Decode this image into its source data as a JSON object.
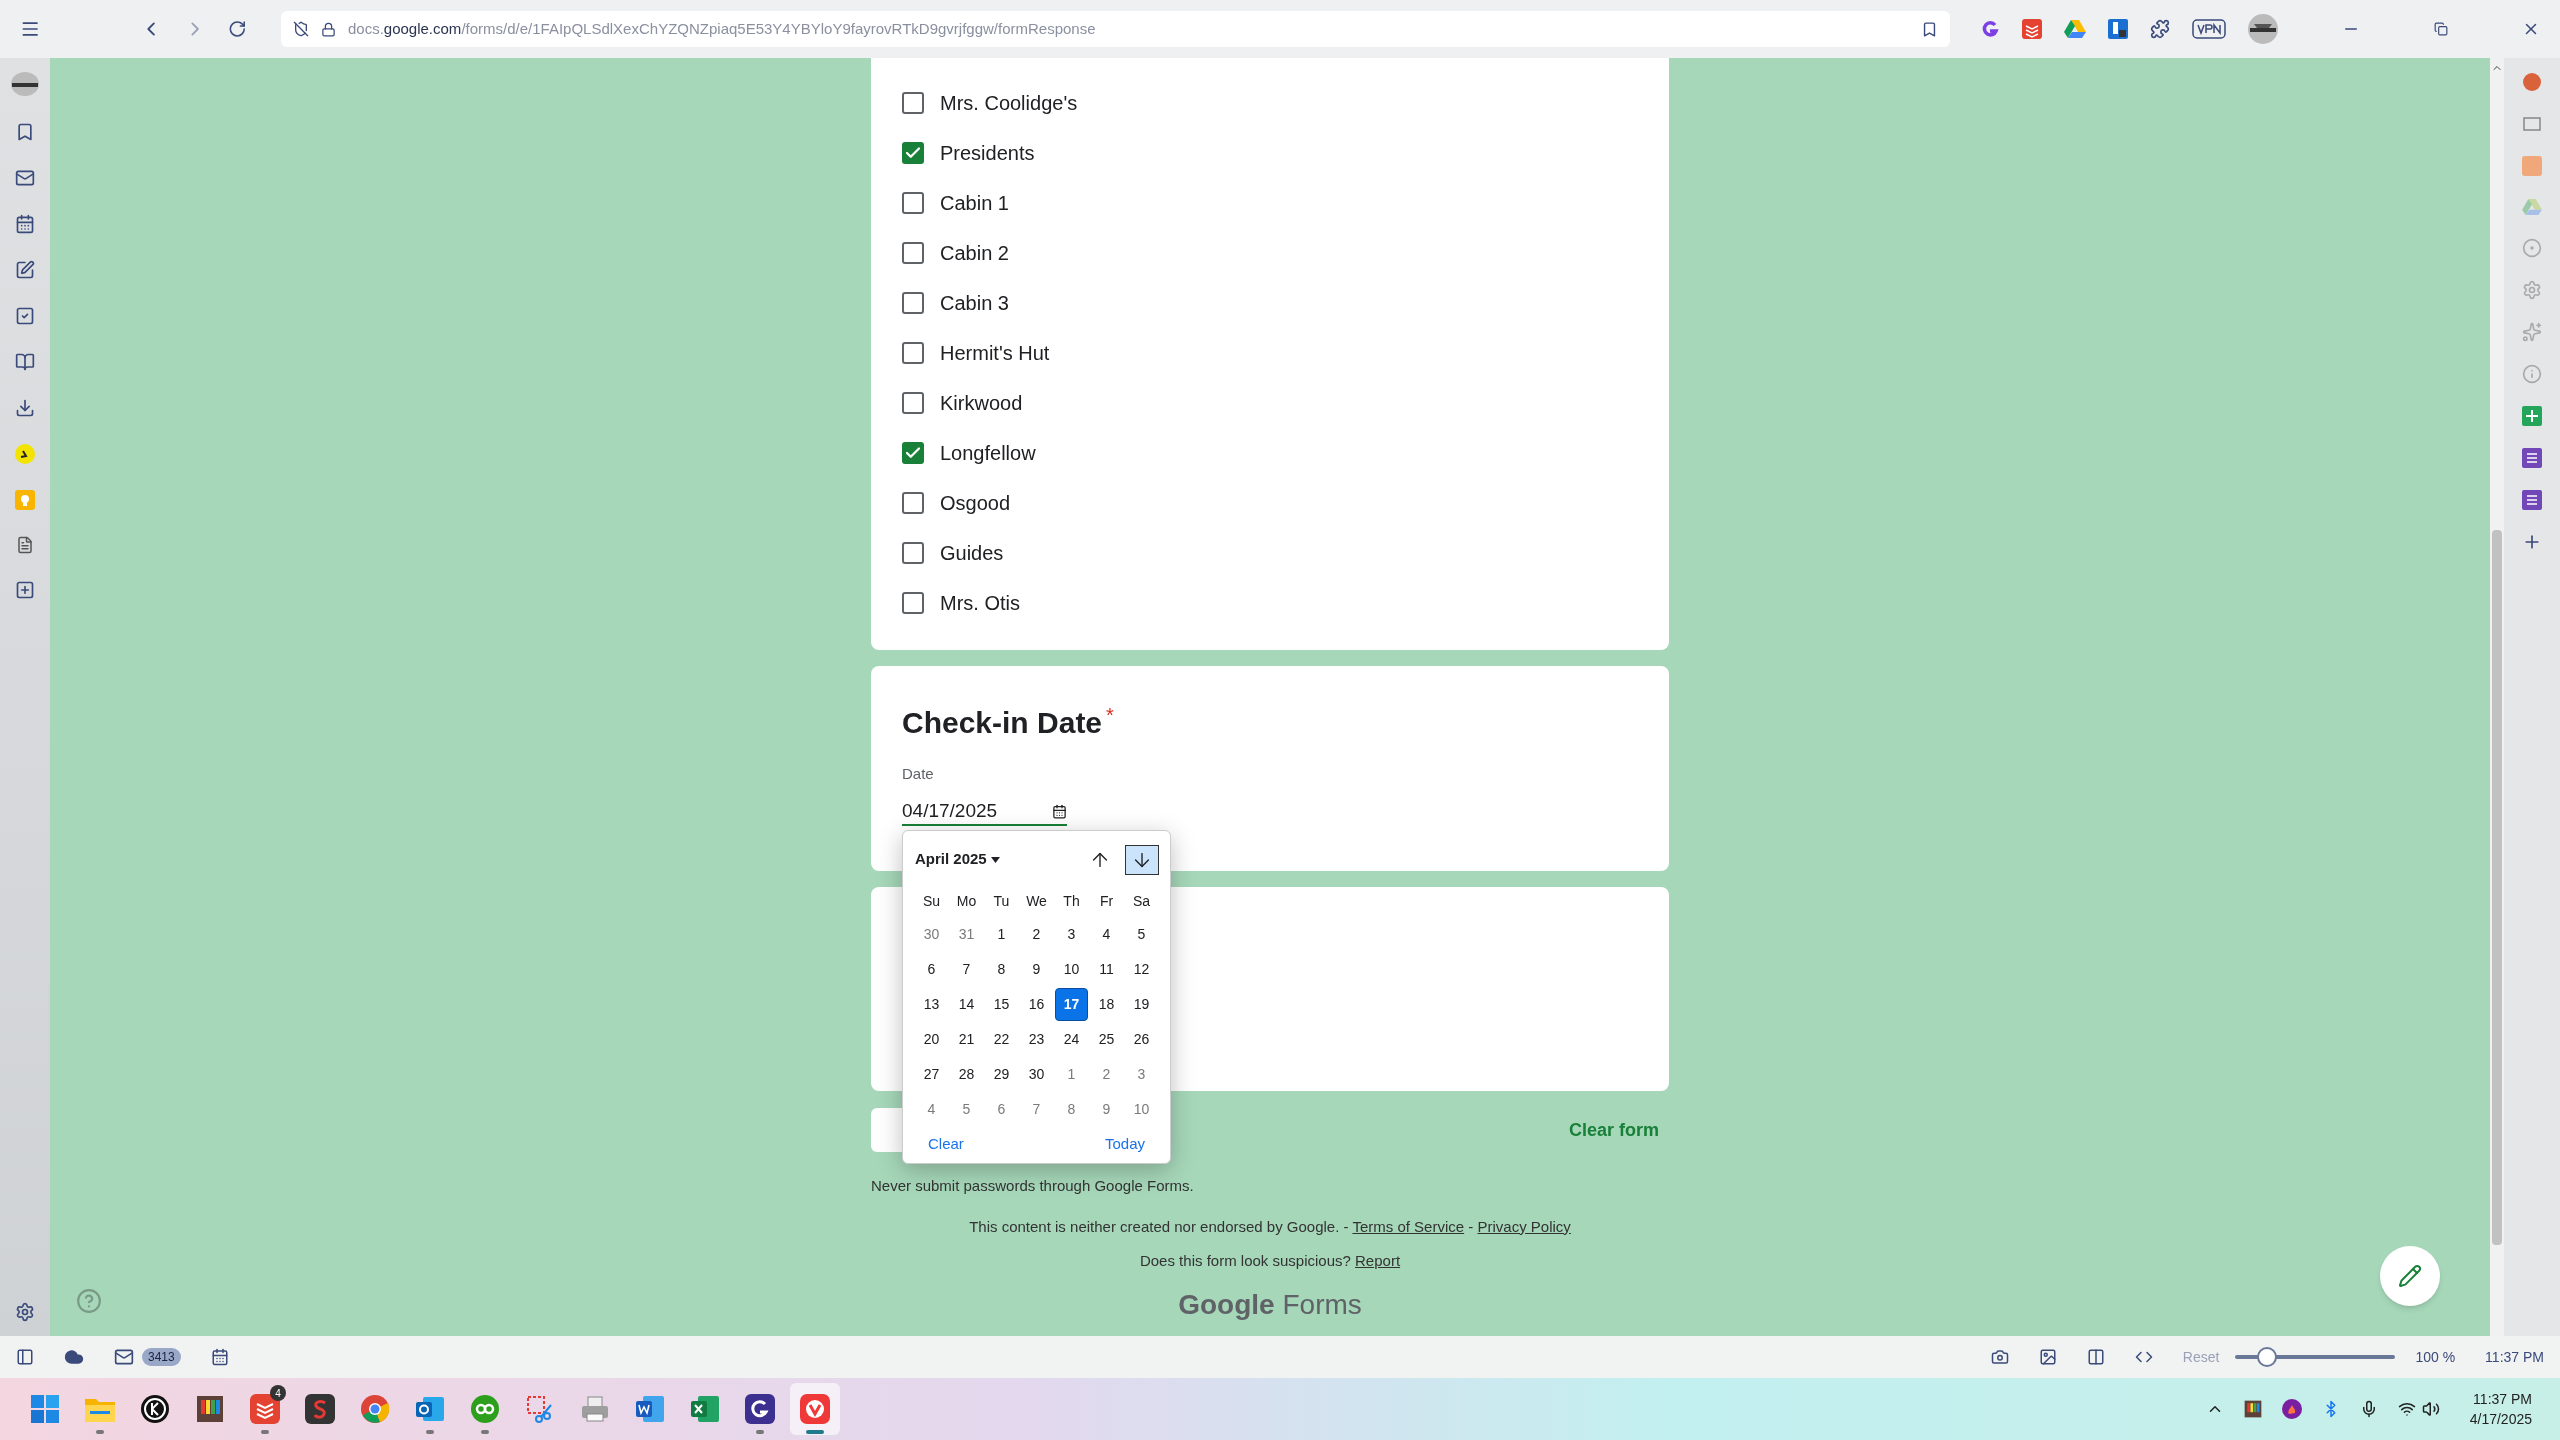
{
  "address_bar": {
    "host_prefix": "docs.",
    "host_domain": "google.com",
    "path": "/forms/d/e/1FAIpQLSdlXexChYZQNZpiaq5E53Y4YBYloY9fayrovRTkD9gvrjfggw/formResponse"
  },
  "options": [
    {
      "label": "Mrs. Coolidge's",
      "checked": false
    },
    {
      "label": "Presidents",
      "checked": true
    },
    {
      "label": "Cabin 1",
      "checked": false
    },
    {
      "label": "Cabin 2",
      "checked": false
    },
    {
      "label": "Cabin 3",
      "checked": false
    },
    {
      "label": "Hermit's Hut",
      "checked": false
    },
    {
      "label": "Kirkwood",
      "checked": false
    },
    {
      "label": "Longfellow",
      "checked": true
    },
    {
      "label": "Osgood",
      "checked": false
    },
    {
      "label": "Guides",
      "checked": false
    },
    {
      "label": "Mrs. Otis",
      "checked": false
    }
  ],
  "check_in": {
    "title": "Check-in Date",
    "required_mark": "*",
    "field_label": "Date",
    "value": "04/17/2025"
  },
  "date_picker": {
    "month": "April 2025",
    "weekdays": [
      "Su",
      "Mo",
      "Tu",
      "We",
      "Th",
      "Fr",
      "Sa"
    ],
    "weeks": [
      [
        {
          "day": "30",
          "current_month": false,
          "selected": false
        },
        {
          "day": "31",
          "current_month": false,
          "selected": false
        },
        {
          "day": "1",
          "current_month": true,
          "selected": false
        },
        {
          "day": "2",
          "current_month": true,
          "selected": false
        },
        {
          "day": "3",
          "current_month": true,
          "selected": false
        },
        {
          "day": "4",
          "current_month": true,
          "selected": false
        },
        {
          "day": "5",
          "current_month": true,
          "selected": false
        }
      ],
      [
        {
          "day": "6",
          "current_month": true,
          "selected": false
        },
        {
          "day": "7",
          "current_month": true,
          "selected": false
        },
        {
          "day": "8",
          "current_month": true,
          "selected": false
        },
        {
          "day": "9",
          "current_month": true,
          "selected": false
        },
        {
          "day": "10",
          "current_month": true,
          "selected": false
        },
        {
          "day": "11",
          "current_month": true,
          "selected": false
        },
        {
          "day": "12",
          "current_month": true,
          "selected": false
        }
      ],
      [
        {
          "day": "13",
          "current_month": true,
          "selected": false
        },
        {
          "day": "14",
          "current_month": true,
          "selected": false
        },
        {
          "day": "15",
          "current_month": true,
          "selected": false
        },
        {
          "day": "16",
          "current_month": true,
          "selected": false
        },
        {
          "day": "17",
          "current_month": true,
          "selected": true
        },
        {
          "day": "18",
          "current_month": true,
          "selected": false
        },
        {
          "day": "19",
          "current_month": true,
          "selected": false
        }
      ],
      [
        {
          "day": "20",
          "current_month": true,
          "selected": false
        },
        {
          "day": "21",
          "current_month": true,
          "selected": false
        },
        {
          "day": "22",
          "current_month": true,
          "selected": false
        },
        {
          "day": "23",
          "current_month": true,
          "selected": false
        },
        {
          "day": "24",
          "current_month": true,
          "selected": false
        },
        {
          "day": "25",
          "current_month": true,
          "selected": false
        },
        {
          "day": "26",
          "current_month": true,
          "selected": false
        }
      ],
      [
        {
          "day": "27",
          "current_month": true,
          "selected": false
        },
        {
          "day": "28",
          "current_month": true,
          "selected": false
        },
        {
          "day": "29",
          "current_month": true,
          "selected": false
        },
        {
          "day": "30",
          "current_month": true,
          "selected": false
        },
        {
          "day": "1",
          "current_month": false,
          "selected": false
        },
        {
          "day": "2",
          "current_month": false,
          "selected": false
        },
        {
          "day": "3",
          "current_month": false,
          "selected": false
        }
      ],
      [
        {
          "day": "4",
          "current_month": false,
          "selected": false
        },
        {
          "day": "5",
          "current_month": false,
          "selected": false
        },
        {
          "day": "6",
          "current_month": false,
          "selected": false
        },
        {
          "day": "7",
          "current_month": false,
          "selected": false
        },
        {
          "day": "8",
          "current_month": false,
          "selected": false
        },
        {
          "day": "9",
          "current_month": false,
          "selected": false
        },
        {
          "day": "10",
          "current_month": false,
          "selected": false
        }
      ]
    ],
    "clear": "Clear",
    "today": "Today"
  },
  "clear_form": "Clear form",
  "footer": {
    "warning": "Never submit passwords through Google Forms.",
    "disclaimer": "This content is neither created nor endorsed by Google. - ",
    "terms": "Terms of Service",
    "separator": " - ",
    "privacy": "Privacy Policy",
    "suspicious": "Does this form look suspicious? ",
    "report": "Report",
    "logo_google": "Google",
    "logo_forms": "Forms"
  },
  "status_bar": {
    "mail_count": "3413",
    "reset": "Reset",
    "zoom": {
      "level": 0.2
    },
    "zoom_reading": "100 %",
    "time": "11:37 PM"
  },
  "taskbar": {
    "apps": [
      {
        "kind": "windows",
        "running": false,
        "selected": false
      },
      {
        "kind": "folder",
        "running": true,
        "selected": false
      },
      {
        "kind": "clock",
        "running": false,
        "selected": false
      },
      {
        "kind": "palette",
        "running": false,
        "selected": false
      },
      {
        "kind": "todo",
        "running": true,
        "selected": false,
        "badge": "4"
      },
      {
        "kind": "sketch",
        "running": false,
        "selected": false
      },
      {
        "kind": "chrome",
        "running": false,
        "selected": false
      },
      {
        "kind": "outlook",
        "running": true,
        "selected": false
      },
      {
        "kind": "books",
        "running": true,
        "selected": false
      },
      {
        "kind": "snip",
        "running": false,
        "selected": false
      },
      {
        "kind": "printer",
        "running": false,
        "selected": false
      },
      {
        "kind": "word",
        "running": false,
        "selected": false
      },
      {
        "kind": "excel",
        "running": false,
        "selected": false
      },
      {
        "kind": "gapp",
        "running": true,
        "selected": false
      },
      {
        "kind": "vivaldi",
        "running": true,
        "selected": true
      }
    ],
    "time": "11:37 PM",
    "date": "4/17/2025"
  }
}
